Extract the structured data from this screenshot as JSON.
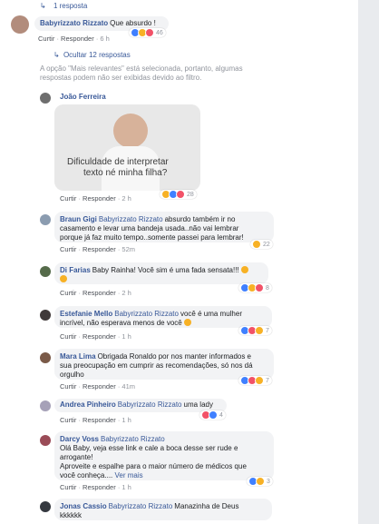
{
  "top_replies": {
    "arrow": "↳",
    "label": "1 resposta"
  },
  "comment_main": {
    "author": "Babyrizzato Rizzato",
    "text": "Que absurdo !",
    "actions": [
      "Curtir",
      "Responder",
      "6 h"
    ],
    "reaction_count": "46"
  },
  "hide_replies": {
    "arrow": "↳",
    "label": "Ocultar 12 respostas"
  },
  "filter_notice": {
    "line1": "A opção \"Mais relevantes\" está selecionada, portanto, algumas",
    "line2": "respostas podem não ser exibidas devido ao filtro."
  },
  "replies": [
    {
      "author": "João Ferreira",
      "image_caption_1": "Dificuldade de interpretar",
      "image_caption_2": "texto né minha filha?",
      "actions": [
        "Curtir",
        "Responder",
        "2 h"
      ],
      "reaction_count": "28"
    },
    {
      "author": "Braun Gigi",
      "tag": "Babyrizzato Rizzato",
      "text_1": "absurdo também ir no",
      "text_2": "casamento e levar uma bandeja usada..não vai lembrar",
      "text_3": "porque já faz muito tempo..somente passei para lembrar!",
      "actions": [
        "Curtir",
        "Responder",
        "52m"
      ],
      "reaction_count": "22"
    },
    {
      "author": "Di Farias",
      "text_1": "Baby Rainha! Você sim é uma fada sensata!!!",
      "actions": [
        "Curtir",
        "Responder",
        "2 h"
      ],
      "reaction_count": "8"
    },
    {
      "author": "Estefanie Mello",
      "tag": "Babyrizzato Rizzato",
      "text_1": "você é uma mulher",
      "text_2": "incrível, não esperava menos de você",
      "actions": [
        "Curtir",
        "Responder",
        "1 h"
      ],
      "reaction_count": "7"
    },
    {
      "author": "Mara Lima",
      "text_1": "Obrigada Ronaldo por nos manter informados e",
      "text_2": "sua preocupação em cumprir as recomendações, só nos dá",
      "text_3": "orgulho",
      "actions": [
        "Curtir",
        "Responder",
        "41m"
      ],
      "reaction_count": "7"
    },
    {
      "author": "Andrea Pinheiro",
      "tag": "Babyrizzato Rizzato",
      "text_1": "uma lady",
      "actions": [
        "Curtir",
        "Responder",
        "1 h"
      ],
      "reaction_count": "4"
    },
    {
      "author": "Darcy Voss",
      "tag": "Babyrizzato Rizzato",
      "text_1": "Olá Baby, veja esse link e cale a boca desse ser rude e",
      "text_2": "arrogante!",
      "text_3": "Aproveite e espalhe para o maior número de médicos que",
      "text_4": "você conheça....",
      "see_more": "Ver mais",
      "actions": [
        "Curtir",
        "Responder",
        "1 h"
      ],
      "reaction_count": "3"
    },
    {
      "author": "Jonas Cassio",
      "tag": "Babyrizzato Rizzato",
      "text_1": "Manazinha de Deus",
      "text_2": "kkkkkk"
    }
  ],
  "action_separator": "·",
  "colors": {
    "link": "#385898",
    "bubble": "#f2f3f5",
    "like": "#4080ff",
    "love": "#f25268",
    "haha": "#f7b125"
  }
}
